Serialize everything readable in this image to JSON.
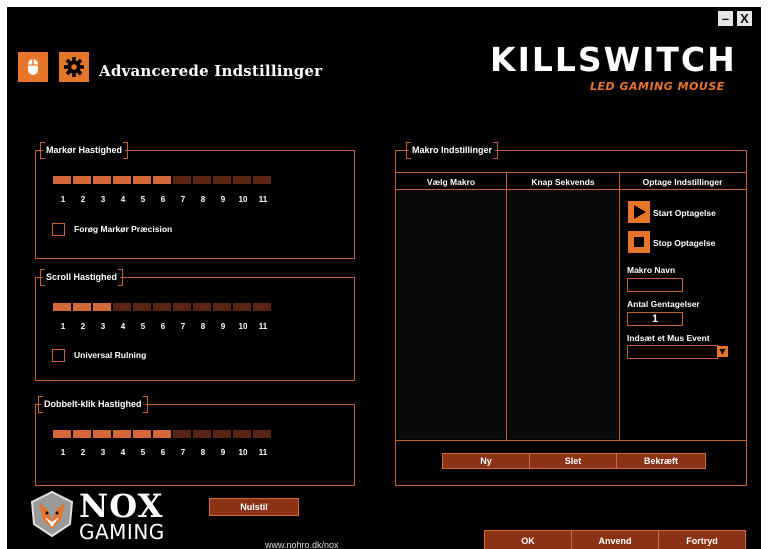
{
  "window": {
    "minimize_label": "–",
    "close_label": "X"
  },
  "header": {
    "title": "Advancerede Indstillinger",
    "brand": "KILLSWITCH",
    "brand_sub": "LED GAMING MOUSE",
    "mouse_icon": "mouse-icon",
    "settings_icon": "gear-icon"
  },
  "cursor_speed": {
    "label": "Markør Hastighed",
    "numbers": [
      "1",
      "2",
      "3",
      "4",
      "5",
      "6",
      "7",
      "8",
      "9",
      "10",
      "11"
    ],
    "level": 6,
    "checkbox_label": "Forøg Markør Præcision",
    "checked": false
  },
  "scroll_speed": {
    "label": "Scroll Hastighed",
    "numbers": [
      "1",
      "2",
      "3",
      "4",
      "5",
      "6",
      "7",
      "8",
      "9",
      "10",
      "11"
    ],
    "level": 3,
    "checkbox_label": "Universal Rulning",
    "checked": false
  },
  "double_click_speed": {
    "label": "Dobbelt-klik Hastighed",
    "numbers": [
      "1",
      "2",
      "3",
      "4",
      "5",
      "6",
      "7",
      "8",
      "9",
      "10",
      "11"
    ],
    "level": 6
  },
  "macro": {
    "label": "Makro Indstillinger",
    "col_select": "Vælg Makro",
    "col_sequence": "Knap Sekvends",
    "col_record": "Optage Indstillinger",
    "start_record": "Start Optagelse",
    "stop_record": "Stop Optagelse",
    "name_label": "Makro Navn",
    "name_value": "",
    "repeat_label": "Antal Gentagelser",
    "repeat_value": "1",
    "mouse_event_label": "Indsæt et Mus Event",
    "mouse_event_value": "",
    "new_label": "Ny",
    "delete_label": "Slet",
    "confirm_label": "Bekræft"
  },
  "footer": {
    "reset_label": "Nulstil",
    "logo_main": "NOX",
    "logo_sub": "GAMING",
    "url": "www.nohro.dk/nox",
    "ok_label": "OK",
    "apply_label": "Anvend",
    "cancel_label": "Fortryd"
  },
  "colors": {
    "accent": "#e8762a",
    "segment_on": "#d5683a",
    "segment_off": "#5a2414",
    "border": "#c5612b",
    "button_bg": "#8c3317"
  }
}
